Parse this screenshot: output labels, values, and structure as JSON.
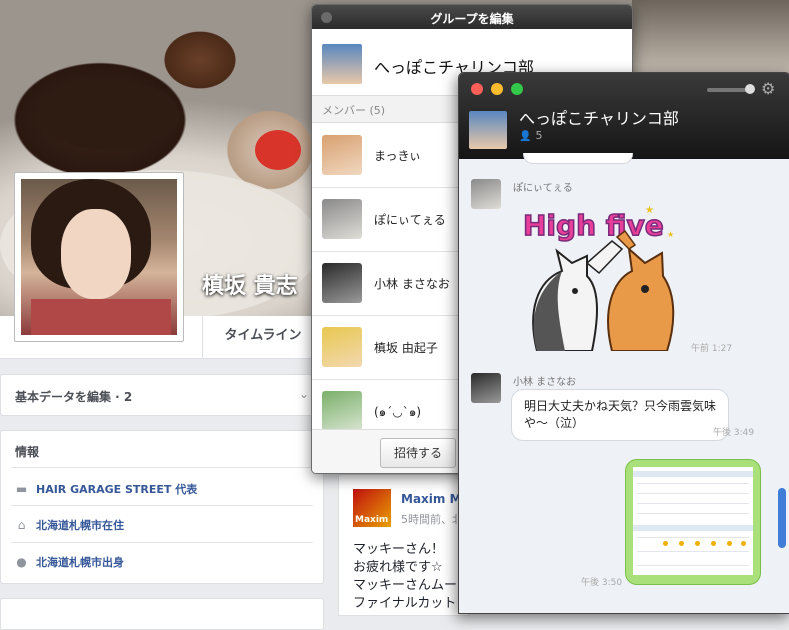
{
  "profile": {
    "name": "槙坂 貴志",
    "timeline_tab": "タイムライン"
  },
  "left": {
    "basic_data": "基本データを編集 · 2",
    "info_header": "情報",
    "info_items": [
      {
        "icon": "briefcase-icon",
        "text": "HAIR GARAGE STREET 代表"
      },
      {
        "icon": "home-icon",
        "text": "北海道札幌市在住"
      },
      {
        "icon": "location-pin-icon",
        "text": "北海道札幌市出身"
      }
    ]
  },
  "post": {
    "author": "Maxim Ma",
    "time": "5時間前、北",
    "avatar_text": "Maxim",
    "lines": [
      "マッキーさん！",
      "お疲れ様です☆",
      "マッキーさんムー",
      "ファイナルカット"
    ]
  },
  "group_editor": {
    "title": "グループを編集",
    "group_name": "へっぽこチャリンコ部",
    "members_header": "メンバー (5)",
    "members": [
      "まっきぃ",
      "ぽにぃてぇる",
      "小林 まさなお",
      "槙坂 由起子",
      "(๑´◡`๑)"
    ],
    "invite_button": "招待する"
  },
  "chat": {
    "group_name": "へっぽこチャリンコ部",
    "member_count": "5",
    "colors": {
      "close": "#fc5f57",
      "minimize": "#fdbc2e",
      "zoom": "#34c84a",
      "image_bubble": "#a9e07a",
      "scroll_thumb": "#3f7dd8"
    },
    "messages": [
      {
        "sender": "ぽにぃてぇる",
        "type": "sticker",
        "sticker_text": "High five",
        "time": "午前 1:27"
      },
      {
        "sender": "小林 まさなお",
        "type": "text",
        "text": "明日大丈夫かね天気？只今雨雲気味や〜（泣）",
        "time": "午後 3:49"
      },
      {
        "sender": "",
        "type": "image",
        "time": "午後 3:50"
      }
    ]
  }
}
